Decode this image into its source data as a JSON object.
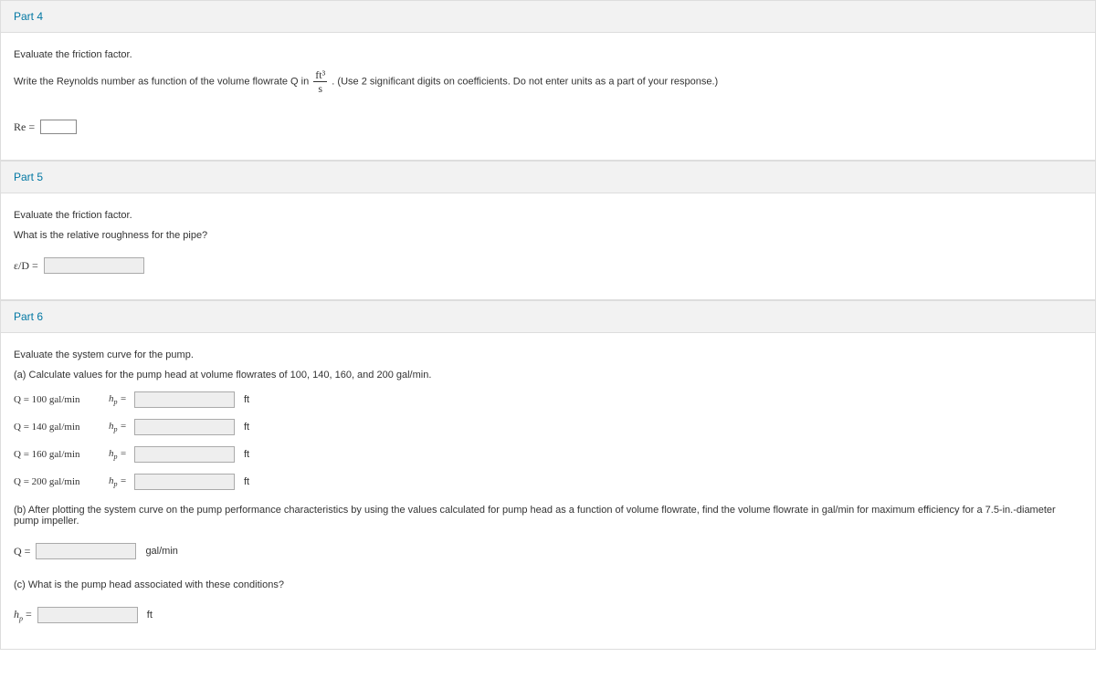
{
  "part4": {
    "title": "Part 4",
    "instruction1": "Evaluate the friction factor.",
    "instruction2_pre": "Write the Reynolds number as function of the volume flowrate Q in ",
    "instruction2_unit_num": "ft³",
    "instruction2_unit_den": "s",
    "instruction2_post": ". (Use 2 significant digits on coefficients. Do not enter units as a part of your response.)",
    "label": "Re ="
  },
  "part5": {
    "title": "Part 5",
    "instruction1": "Evaluate the friction factor.",
    "instruction2": "What is the relative roughness for the pipe?",
    "label": "ε/D ="
  },
  "part6": {
    "title": "Part 6",
    "instruction1": "Evaluate the system curve for the pump.",
    "instruction_a": "(a) Calculate values for the pump head at volume flowrates of 100, 140, 160, and 200 gal/min.",
    "rows": [
      {
        "q": "Q = 100 gal/min",
        "hp": "hₚ =",
        "unit": "ft"
      },
      {
        "q": "Q = 140 gal/min",
        "hp": "hₚ =",
        "unit": "ft"
      },
      {
        "q": "Q = 160 gal/min",
        "hp": "hₚ =",
        "unit": "ft"
      },
      {
        "q": "Q = 200 gal/min",
        "hp": "hₚ =",
        "unit": "ft"
      }
    ],
    "instruction_b": "(b) After plotting the system curve on the pump performance characteristics by using the values calculated for pump head as a function of volume flowrate, find the volume flowrate in gal/min for maximum efficiency for a 7.5-in.-diameter pump impeller.",
    "q_label": "Q =",
    "q_unit": "gal/min",
    "instruction_c": "(c) What is the pump head associated with these conditions?",
    "hp_label": "hₚ =",
    "hp_unit": "ft"
  }
}
